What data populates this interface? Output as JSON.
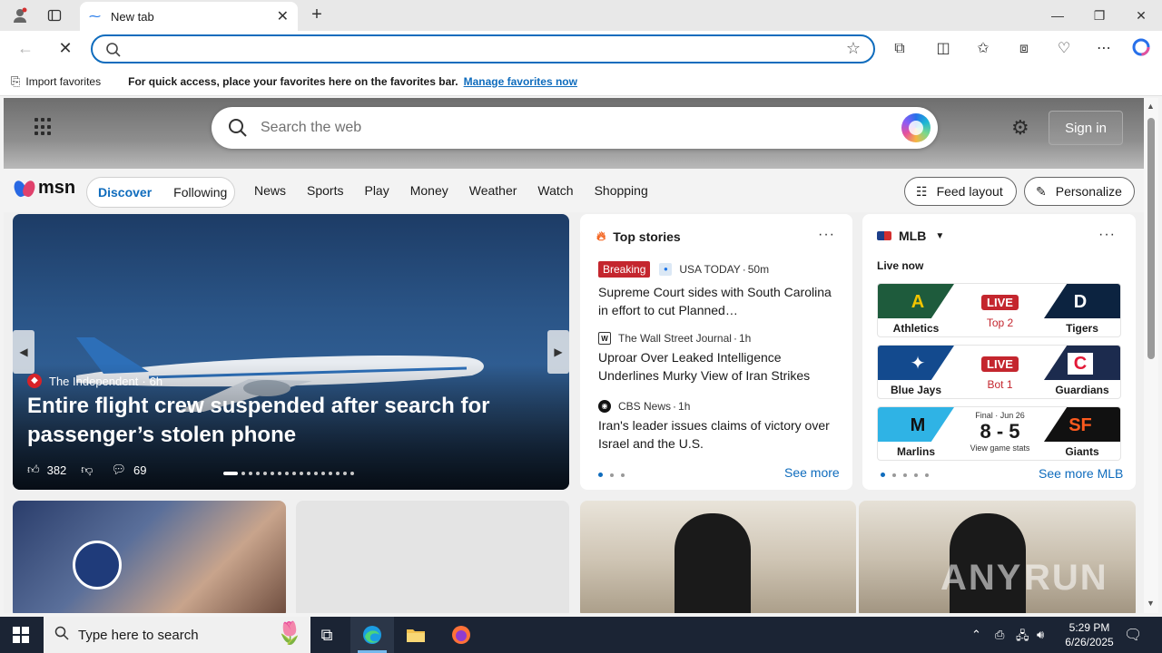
{
  "browser": {
    "tab_title": "New tab",
    "favorites_bar": {
      "import_label": "Import favorites",
      "message": "For quick access, place your favorites here on the favorites bar.",
      "manage_link": "Manage favorites now"
    }
  },
  "msn": {
    "search_placeholder": "Search the web",
    "sign_in": "Sign in",
    "logo_text": "msn",
    "discover": "Discover",
    "following": "Following",
    "nav": [
      "News",
      "Sports",
      "Play",
      "Money",
      "Weather",
      "Watch",
      "Shopping"
    ],
    "feed_layout": "Feed layout",
    "personalize": "Personalize",
    "hero": {
      "source": "The Independent",
      "age": "6h",
      "headline": "Entire flight crew suspended after search for passenger’s stolen phone",
      "likes": "382",
      "comments": "69"
    },
    "top_stories": {
      "title": "Top stories",
      "see_more": "See more",
      "stories": [
        {
          "badge": "Breaking",
          "source": "USA TODAY",
          "age": "50m",
          "title": "Supreme Court sides with South Carolina in effort to cut Planned…"
        },
        {
          "source": "The Wall Street Journal",
          "age": "1h",
          "title": "Uproar Over Leaked Intelligence Underlines Murky View of Iran Strikes"
        },
        {
          "source": "CBS News",
          "age": "1h",
          "title": "Iran's leader issues claims of victory over Israel and the U.S."
        }
      ]
    },
    "mlb": {
      "title": "MLB",
      "live_now": "Live now",
      "see_more": "See more MLB",
      "games": [
        {
          "home": "Athletics",
          "away": "Tigers",
          "status": "LIVE",
          "detail": "Top 2"
        },
        {
          "home": "Blue Jays",
          "away": "Guardians",
          "status": "LIVE",
          "detail": "Bot 1"
        },
        {
          "home": "Marlins",
          "away": "Giants",
          "status": "Final · Jun 26",
          "score": "8 - 5",
          "detail": "View game stats"
        }
      ]
    }
  },
  "taskbar": {
    "search_placeholder": "Type here to search",
    "time": "5:29 PM",
    "date": "6/26/2025"
  },
  "watermark": "ANY.RUN"
}
